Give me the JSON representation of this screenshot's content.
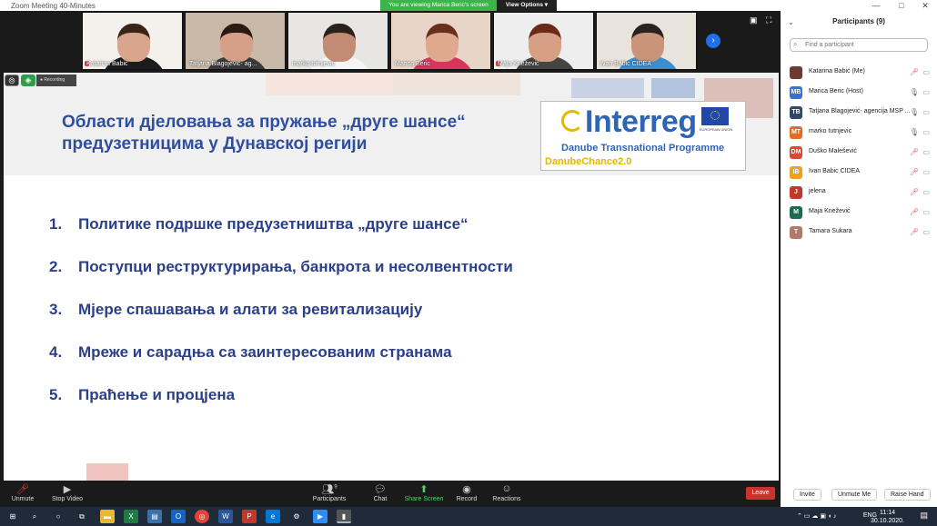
{
  "window": {
    "title": "Zoom Meeting 40-Minutes",
    "banner": "You are viewing Marica Beric's screen",
    "view_options": "View Options"
  },
  "thumbnails": [
    {
      "name": "Katarina Babić",
      "muted": true,
      "bg": "#f4f0ec",
      "skin": "#d9a58c",
      "hair": "#3a2418",
      "shirt": "#1c1c1c"
    },
    {
      "name": "Tatjana Blagojević- ag...",
      "muted": false,
      "bg": "#c8b9a8",
      "skin": "#d6a088",
      "hair": "#2a1a10",
      "shirt": "#3b3b3b"
    },
    {
      "name": "marko tutnjevic",
      "muted": false,
      "bg": "#e8e6e2",
      "skin": "#c38b73",
      "hair": "#2b211c",
      "shirt": "#f5f5f5"
    },
    {
      "name": "Marica Beric",
      "muted": false,
      "bg": "#e9d5c8",
      "skin": "#e0a88e",
      "hair": "#6a2f1c",
      "shirt": "#d8345e"
    },
    {
      "name": "Maja Knežević",
      "muted": true,
      "bg": "#eee",
      "skin": "#d7a085",
      "hair": "#6b2a18",
      "shirt": "#444"
    },
    {
      "name": "Ivan Babic CIDEA",
      "muted": false,
      "bg": "#e8e4dc",
      "skin": "#c99478",
      "hair": "#2a2220",
      "shirt": "#3c8ed1"
    }
  ],
  "slide": {
    "title": "Области дјеловања за пружање „друге шансе“ предузетницима у Дунавској регији",
    "logo": {
      "word": "Interreg",
      "programme": "Danube Transnational Programme",
      "project": "DanubeChance2.0",
      "fund": "EUROPEAN UNION"
    },
    "items": [
      {
        "num": "1.",
        "text": "Политике подршке предузетништва „друге шансе“"
      },
      {
        "num": "2.",
        "text": "Поступци реструктурирања, банкрота и несолвентности"
      },
      {
        "num": "3.",
        "text": "Мјере спашавања и алати за ревитализацију"
      },
      {
        "num": "4.",
        "text": "Мреже и сарадња са заинтересованим странама"
      },
      {
        "num": "5.",
        "text": "Праћење и процјена"
      }
    ]
  },
  "toolbar": {
    "unmute": "Unmute",
    "stop_video": "Stop Video",
    "participants": "Participants",
    "participants_count": "9",
    "chat": "Chat",
    "share_screen": "Share Screen",
    "record": "Record",
    "reactions": "Reactions",
    "leave": "Leave"
  },
  "panel": {
    "title": "Participants (9)",
    "search_placeholder": "Find a participant",
    "participants": [
      {
        "initials": "",
        "name": "Katarina Babić (Me)",
        "color": "#6b3c2e",
        "muted": true
      },
      {
        "initials": "MB",
        "name": "Marica Beric (Host)",
        "color": "#3d6fd1",
        "muted": false
      },
      {
        "initials": "TB",
        "name": "Tatjana Blagojević- agencija MSP ...",
        "color": "#2d4a68",
        "muted": false
      },
      {
        "initials": "MT",
        "name": "marko tutnjevic",
        "color": "#e06b2a",
        "muted": false
      },
      {
        "initials": "DM",
        "name": "Duško Malešević",
        "color": "#d64a3a",
        "muted": true
      },
      {
        "initials": "IB",
        "name": "Ivan Babic CIDEA",
        "color": "#f0a020",
        "muted": true
      },
      {
        "initials": "J",
        "name": "jelena",
        "color": "#c0392b",
        "muted": true
      },
      {
        "initials": "M",
        "name": "Maja Knežević",
        "color": "#1e6b52",
        "muted": true
      },
      {
        "initials": "T",
        "name": "Tamara Sukara",
        "color": "#b07a6a",
        "muted": true
      }
    ],
    "invite": "Invite",
    "unmute_me": "Unmute Me",
    "raise_hand": "Raise Hand"
  },
  "taskbar": {
    "lang": "ENG",
    "time": "11:14",
    "date": "30.10.2020."
  }
}
